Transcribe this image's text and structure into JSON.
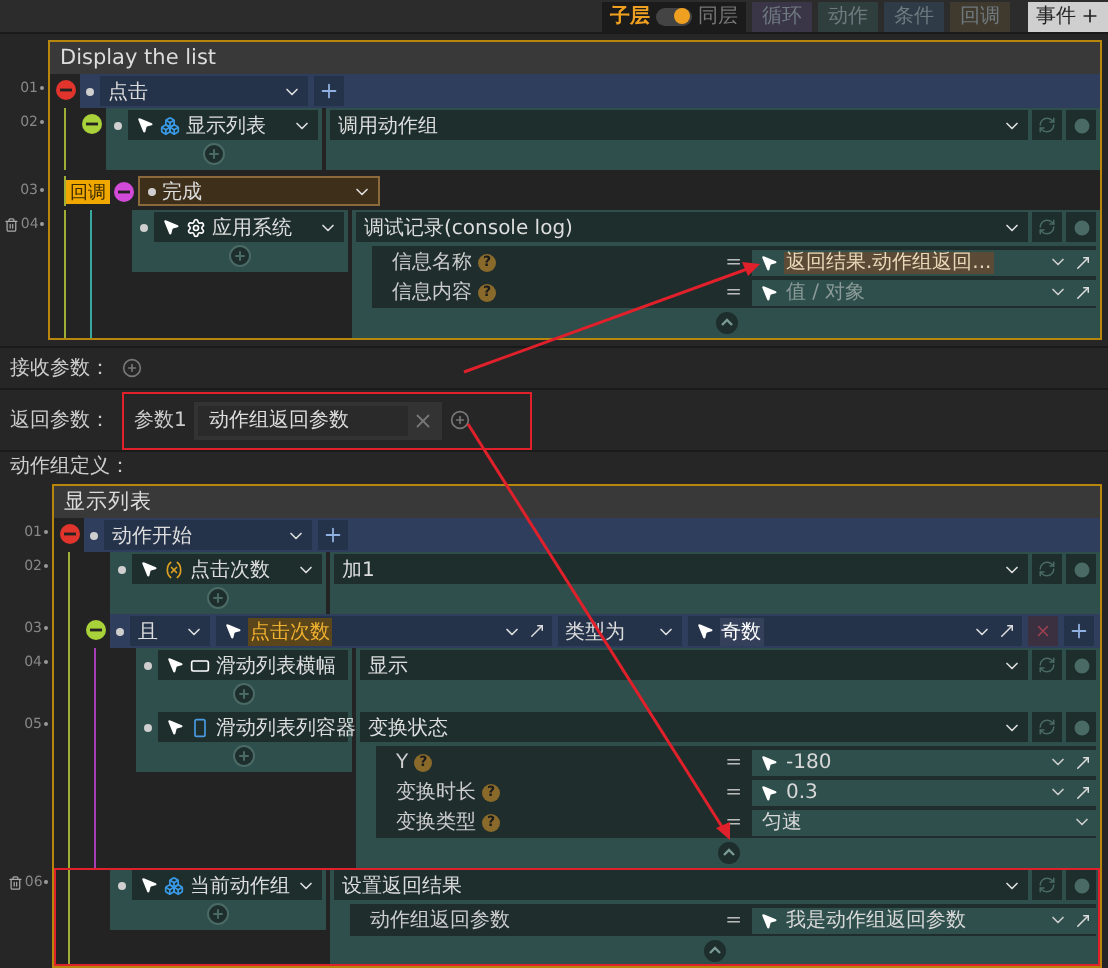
{
  "toolbar": {
    "layer_switch": {
      "on_label": "子层",
      "off_label": "同层",
      "on": true
    },
    "add_buttons": [
      {
        "label": "循环",
        "color": "#3a3547"
      },
      {
        "label": "动作",
        "color": "#2f3f3d"
      },
      {
        "label": "条件",
        "color": "#2f3b47"
      },
      {
        "label": "回调",
        "color": "#403a2e"
      }
    ],
    "event_button": {
      "label": "事件"
    }
  },
  "event_block": {
    "title": "Display the list",
    "rows": [
      {
        "kind": "event",
        "number": "01",
        "hovered": false,
        "highlighted": false,
        "trigger": "点击",
        "children": [
          {
            "kind": "action",
            "number": "02",
            "hovered": false,
            "highlighted": false,
            "collapsible": true,
            "target": {
              "kind": "group",
              "label": "显示列表"
            },
            "action": "调用动作组"
          },
          {
            "kind": "callback",
            "number": "03",
            "hovered": false,
            "highlighted": false,
            "badge": "回调",
            "trigger": "完成",
            "children": [
              {
                "kind": "action",
                "number": "04",
                "hovered": true,
                "highlighted": false,
                "collapsible": false,
                "target": {
                  "kind": "gear",
                  "label": "应用系统"
                },
                "action": "调试记录(console log)",
                "params": [
                  {
                    "kind": "value",
                    "label": "信息名称",
                    "help": "?",
                    "operator": "=",
                    "value": "返回结果.动作组返回...",
                    "highlighted": true
                  },
                  {
                    "kind": "value",
                    "label": "信息内容",
                    "help": "?",
                    "operator": "=",
                    "placeholder": "值 / 对象",
                    "highlighted": false
                  }
                ]
              }
            ]
          }
        ]
      }
    ]
  },
  "parameters": {
    "receive": {
      "label": "接收参数："
    },
    "return": {
      "label": "返回参数：",
      "highlighted": true,
      "items": [
        {
          "name": "参数1",
          "value": "动作组返回参数"
        }
      ]
    },
    "definition_label": "动作组定义："
  },
  "group_block": {
    "title": "显示列表",
    "rows": [
      {
        "kind": "event",
        "number": "01",
        "hovered": false,
        "highlighted": false,
        "trigger": "动作开始",
        "children": [
          {
            "kind": "action",
            "number": "02",
            "hovered": false,
            "highlighted": false,
            "collapsible": false,
            "target": {
              "kind": "variable",
              "label": "点击次数"
            },
            "action": "加1"
          },
          {
            "kind": "condition",
            "number": "03",
            "hovered": false,
            "highlighted": false,
            "operator": "且",
            "left": {
              "label": "点击次数",
              "variable": true
            },
            "relation": "类型为",
            "right": {
              "label": "奇数",
              "variable": false
            },
            "children": [
              {
                "kind": "action",
                "number": "04",
                "hovered": false,
                "highlighted": false,
                "collapsible": false,
                "target": {
                  "kind": "banner",
                  "label": "滑动列表横幅"
                },
                "action": "显示"
              },
              {
                "kind": "action",
                "number": "05",
                "hovered": false,
                "highlighted": false,
                "collapsible": false,
                "target": {
                  "kind": "container",
                  "label": "滑动列表列容器"
                },
                "action": "变换状态",
                "params": [
                  {
                    "kind": "value",
                    "label": "Y",
                    "help": "?",
                    "operator": "=",
                    "value": "-180",
                    "highlighted": false
                  },
                  {
                    "kind": "value",
                    "label": "变换时长",
                    "help": "?",
                    "operator": "=",
                    "value": "0.3",
                    "highlighted": false
                  },
                  {
                    "kind": "select",
                    "label": "变换类型",
                    "help": "?",
                    "operator": "=",
                    "value": "匀速",
                    "highlighted": false
                  }
                ]
              }
            ]
          },
          {
            "kind": "action",
            "number": "06",
            "hovered": true,
            "highlighted": true,
            "collapsible": false,
            "target": {
              "kind": "group",
              "label": "当前动作组"
            },
            "action": "设置返回结果",
            "params": [
              {
                "kind": "value",
                "label": "动作组返回参数",
                "operator": "=",
                "value": "我是动作组返回参数",
                "highlighted": false
              }
            ]
          }
        ]
      }
    ]
  }
}
